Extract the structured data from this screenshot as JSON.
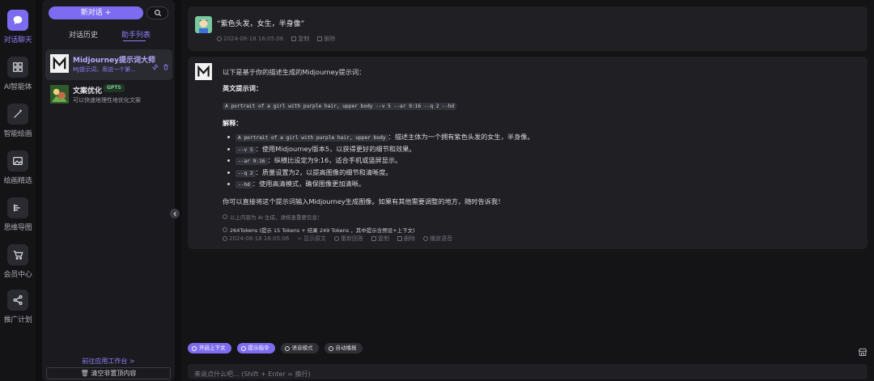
{
  "rail": {
    "items": [
      {
        "label": "对话聊天",
        "icon": "chat-bubble-icon",
        "active": true
      },
      {
        "label": "AI智能体",
        "icon": "grid-icon"
      },
      {
        "label": "智能绘画",
        "icon": "magic-wand-icon"
      },
      {
        "label": "绘画精选",
        "icon": "image-icon"
      },
      {
        "label": "思维导图",
        "icon": "mindmap-icon"
      },
      {
        "label": "会员中心",
        "icon": "cart-icon"
      },
      {
        "label": "推广计划",
        "icon": "share-icon"
      }
    ]
  },
  "panel": {
    "new_chat_label": "新对话 +",
    "tabs": [
      "对话历史",
      "助手列表"
    ],
    "active_tab": 1,
    "assistants": [
      {
        "name": "Midjourney提示词大师",
        "desc": "MJ提示词，用说一个第..."
      },
      {
        "name": "文案优化",
        "badge": "GPTS",
        "desc": "可以快速地理性地优化文案"
      }
    ],
    "goto_workspace": "前往应用工作台 >",
    "clear_label": "清空非置顶内容"
  },
  "chat": {
    "user_message": "“紫色头发，女生，半身像”",
    "user_meta": {
      "time": "2024-08-18 16:05:06",
      "copy": "复制",
      "delete": "删除"
    },
    "reply": {
      "intro": "以下是基于你的描述生成的Midjourney提示词：",
      "en_heading": "英文提示词：",
      "prompt_code": "A portrait of a girl with purple hair, upper body --v 5 --ar 9:16 --q 2 --hd",
      "explain_heading": "解释：",
      "bullets": [
        {
          "code": "A portrait of a girl with purple hair, upper body",
          "text": "：描述主体为一个拥有紫色头发的女生，半身像。"
        },
        {
          "code": "--v 5",
          "text": "：使用Midjourney版本5，以获得更好的细节和效果。"
        },
        {
          "code": "--ar 9:16",
          "text": "：纵横比设定为9:16，适合手机或竖屏显示。"
        },
        {
          "code": "--q 2",
          "text": "：质量设置为2，以提高图像的细节和清晰度。"
        },
        {
          "code": "--hd",
          "text": "：使用高清模式，确保图像更加清晰。"
        }
      ],
      "closing": "你可以直接将这个提示词输入Midjourney生成图像。如果有其他需要调整的地方，随时告诉我！",
      "ai_note": "以上内容为 AI 生成，请核查重要信息！",
      "tokens": "264Tokens (提示 15 Tokens + 结果 249 Tokens ，其中提示含预设+上下文)"
    },
    "reply_meta": {
      "time": "2024-08-18 16:05:06",
      "show_original": "显示原文",
      "regenerate": "重新回答",
      "copy": "复制",
      "delete": "删除",
      "play": "播放语音"
    }
  },
  "bottom": {
    "chips": [
      {
        "label": "开启上下文",
        "on": true
      },
      {
        "label": "提示指令",
        "on": true
      },
      {
        "label": "语音模式",
        "on": false
      },
      {
        "label": "自动播报",
        "on": false
      }
    ],
    "input_placeholder": "来说点什么吧... (Shift + Enter = 换行)"
  },
  "colors": {
    "accent": "#7d6cf0",
    "bg": "#141417",
    "card": "#1f1f24",
    "badge_green": "#6fd08a"
  }
}
